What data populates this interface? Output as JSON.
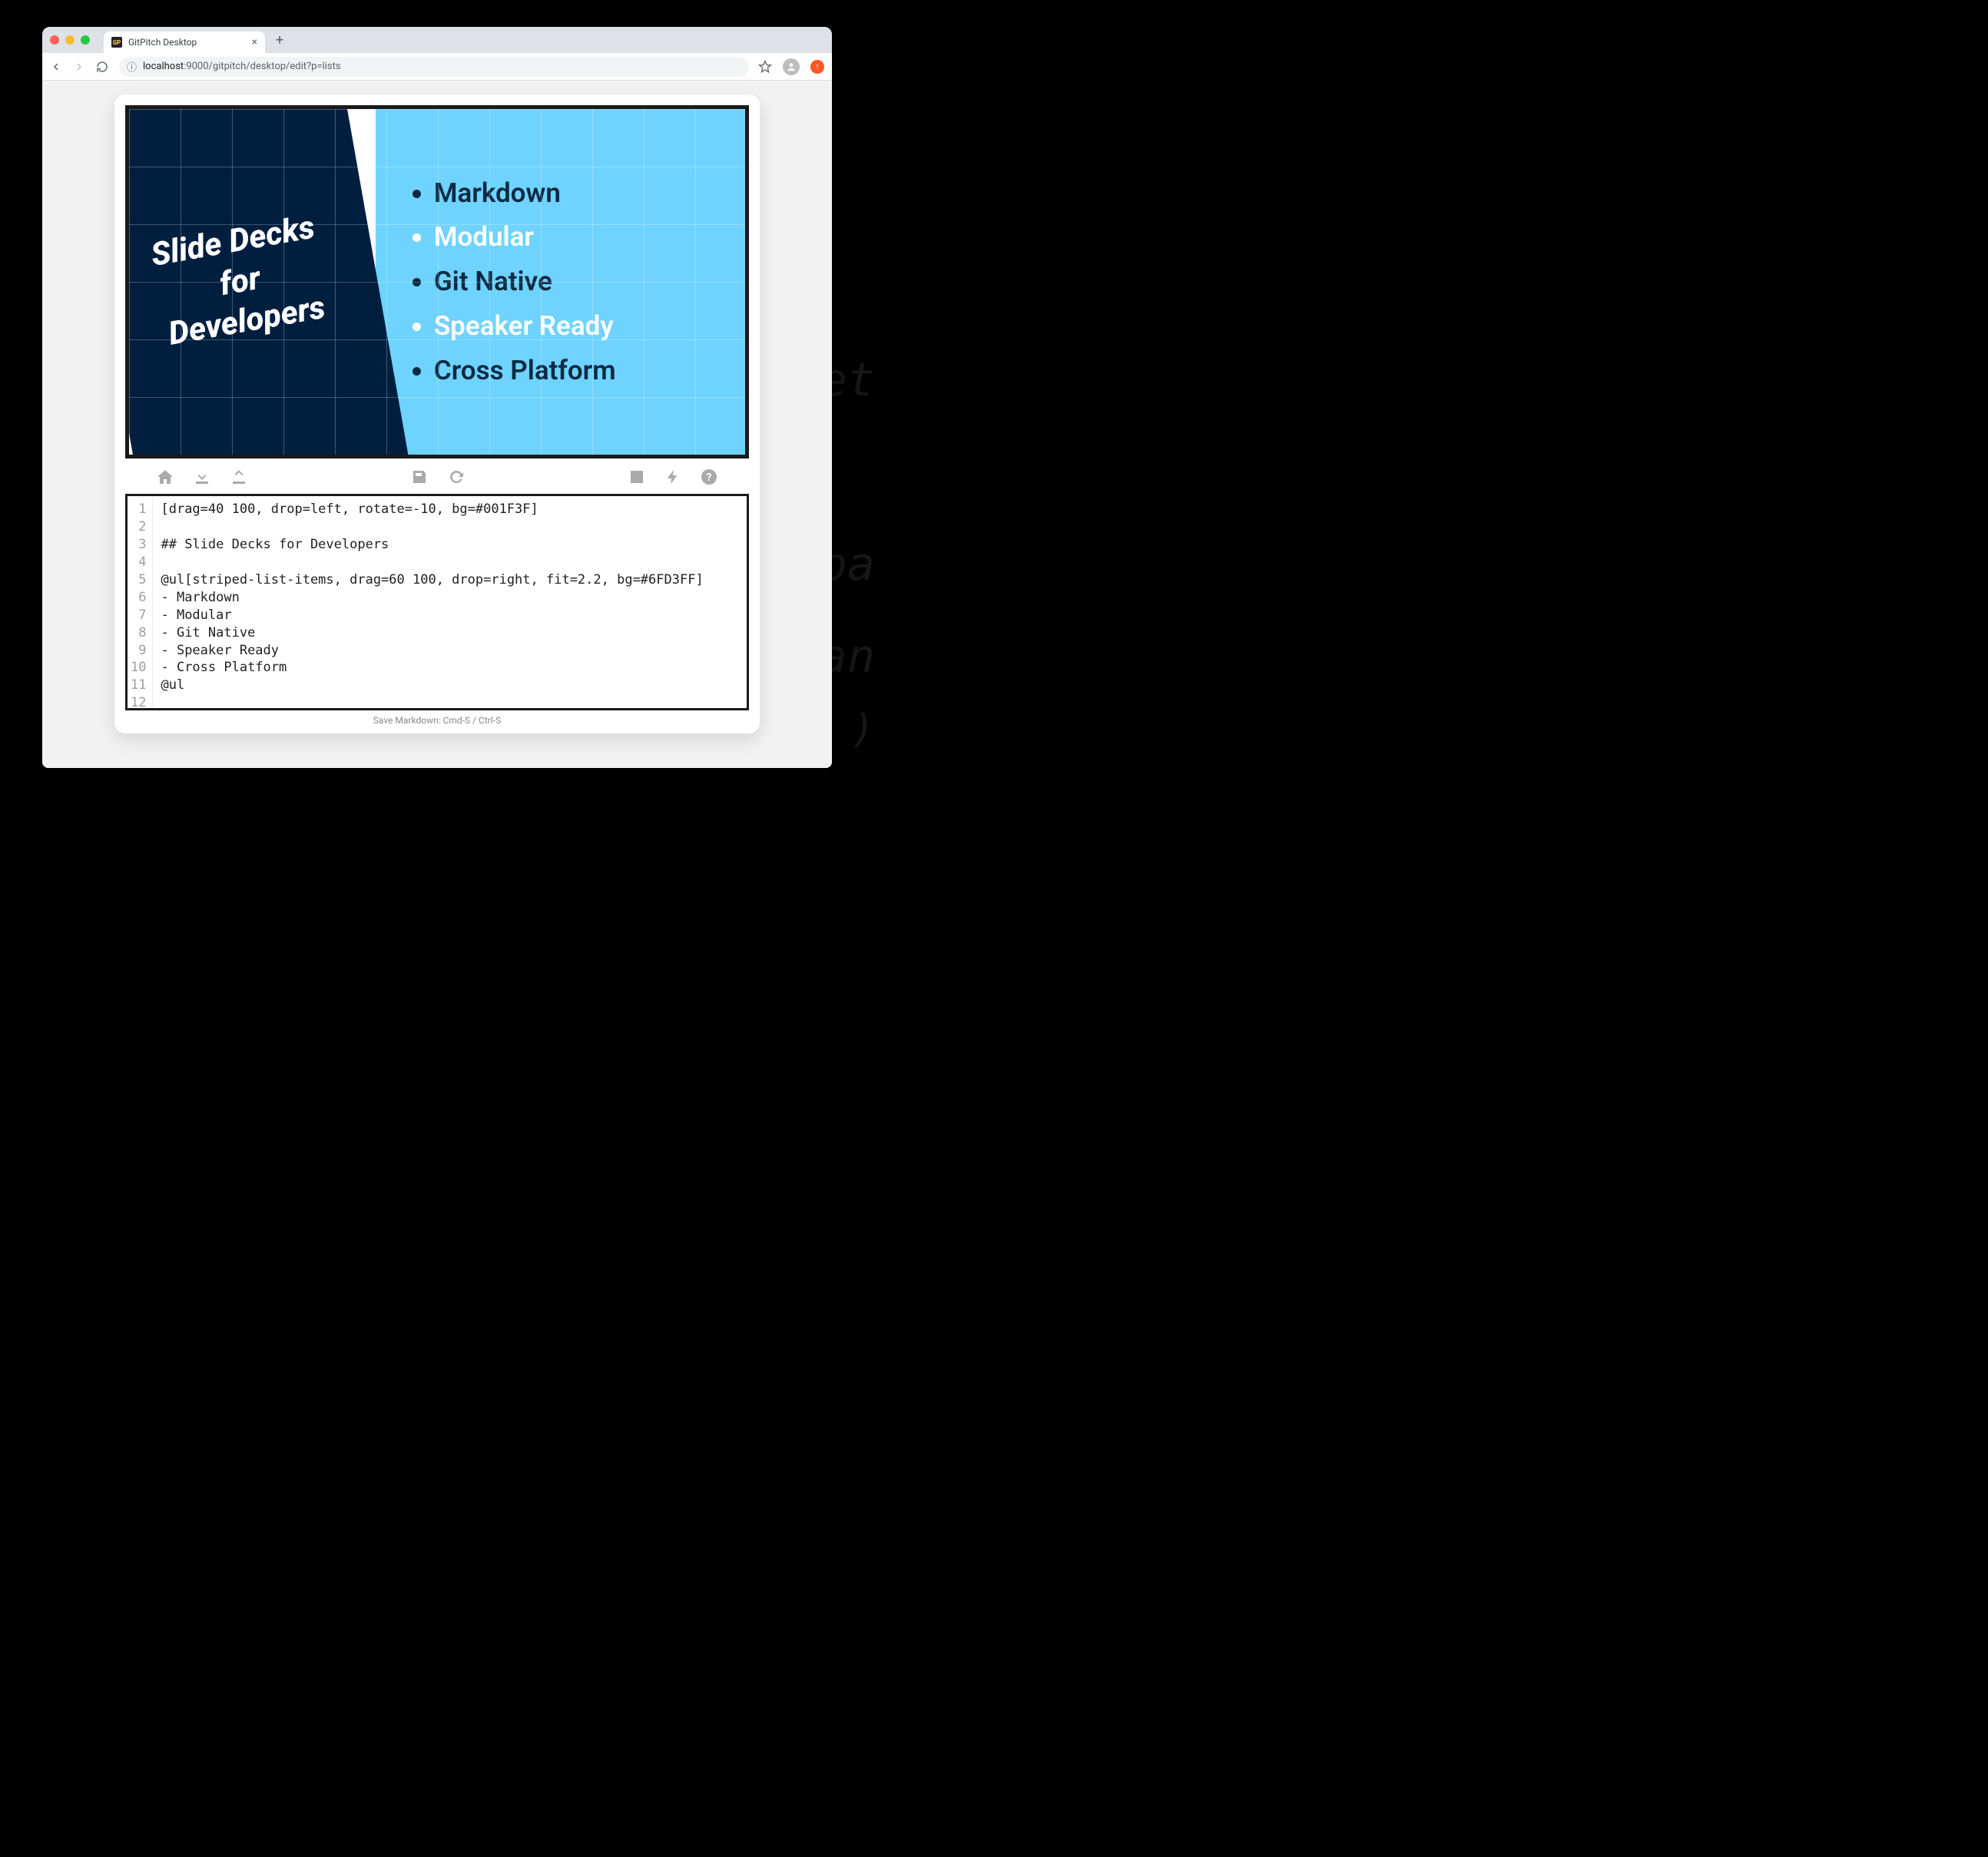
{
  "browser": {
    "tab_title": "GitPitch Desktop",
    "favicon_text": "GP",
    "url_info_icon": "ⓘ",
    "url_host": "localhost",
    "url_port": ":9000",
    "url_path": "/gitpitch/desktop/edit?p=lists"
  },
  "slide": {
    "heading_line1": "Slide Decks",
    "heading_line2": "for",
    "heading_line3": "Developers",
    "list": [
      {
        "text": "Markdown",
        "tone": "dark"
      },
      {
        "text": "Modular",
        "tone": "light"
      },
      {
        "text": "Git Native",
        "tone": "dark"
      },
      {
        "text": "Speaker Ready",
        "tone": "light"
      },
      {
        "text": "Cross Platform",
        "tone": "dark"
      }
    ],
    "colors": {
      "left_bg": "#001F3F",
      "right_bg": "#6FD3FF"
    }
  },
  "toolbar_icons": {
    "home": "home-icon",
    "download": "download-icon",
    "upload": "upload-icon",
    "save": "save-icon",
    "refresh": "refresh-icon",
    "image": "image-icon",
    "bolt": "bolt-icon",
    "help": "help-icon"
  },
  "editor": {
    "lines": [
      "[drag=40 100, drop=left, rotate=-10, bg=#001F3F]",
      "",
      "## Slide Decks for Developers",
      "",
      "@ul[striped-list-items, drag=60 100, drop=right, fit=2.2, bg=#6FD3FF]",
      "- Markdown",
      "- Modular",
      "- Git Native",
      "- Speaker Ready",
      "- Cross Platform",
      "@ul",
      ""
    ]
  },
  "footer": "Save Markdown: Cmd-S / Ctrl-S"
}
